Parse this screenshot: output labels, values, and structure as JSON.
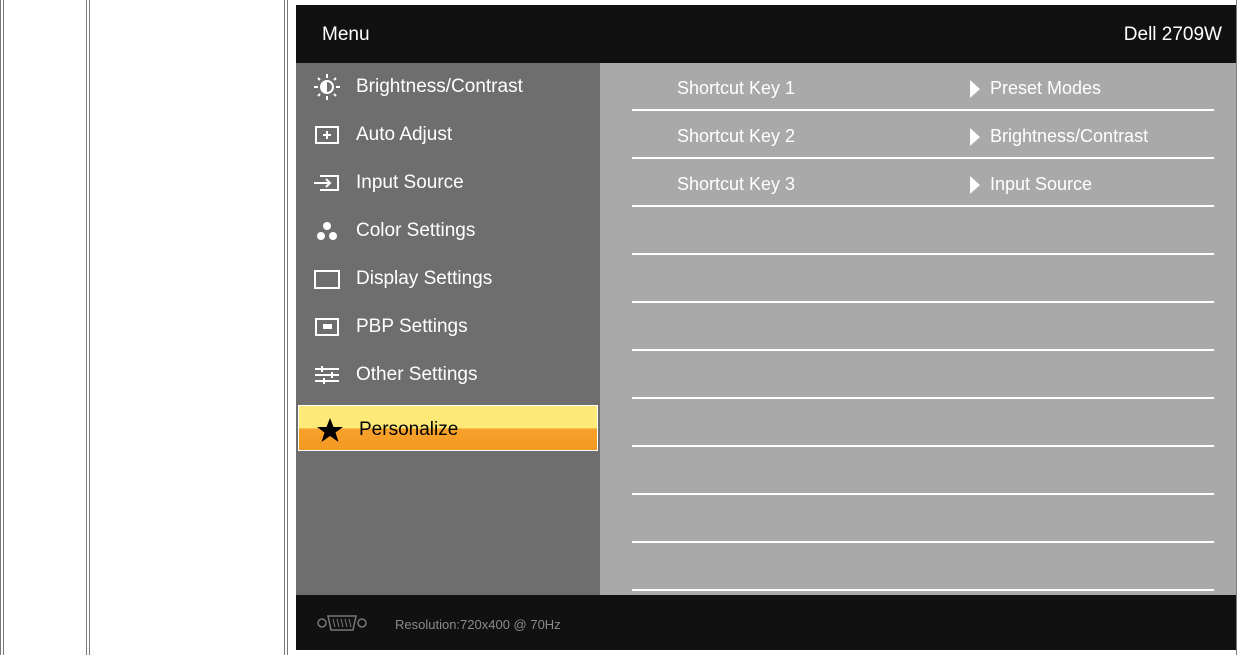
{
  "osd": {
    "title": "Menu",
    "model": "Dell 2709W",
    "menu_items": [
      {
        "label": "Brightness/Contrast",
        "icon": "brightness-icon"
      },
      {
        "label": "Auto Adjust",
        "icon": "auto-adjust-icon"
      },
      {
        "label": "Input Source",
        "icon": "input-source-icon"
      },
      {
        "label": "Color Settings",
        "icon": "color-settings-icon"
      },
      {
        "label": "Display Settings",
        "icon": "display-settings-icon"
      },
      {
        "label": "PBP Settings",
        "icon": "pbp-settings-icon"
      },
      {
        "label": "Other Settings",
        "icon": "other-settings-icon"
      },
      {
        "label": "Personalize",
        "icon": "star-icon",
        "selected": true
      }
    ],
    "shortcuts": [
      {
        "key": "Shortcut Key 1",
        "value": "Preset Modes"
      },
      {
        "key": "Shortcut Key 2",
        "value": "Brightness/Contrast"
      },
      {
        "key": "Shortcut Key 3",
        "value": "Input Source"
      }
    ],
    "footer": {
      "resolution": "Resolution:720x400 @ 70Hz",
      "connector_icon": "vga-connector-icon"
    },
    "colors": {
      "menu_bg": "#6e6e6e",
      "panel_bg": "#a9a9a9",
      "header_bg": "#111111",
      "selected_top": "#fde978",
      "selected_bottom": "#f39a22"
    }
  }
}
